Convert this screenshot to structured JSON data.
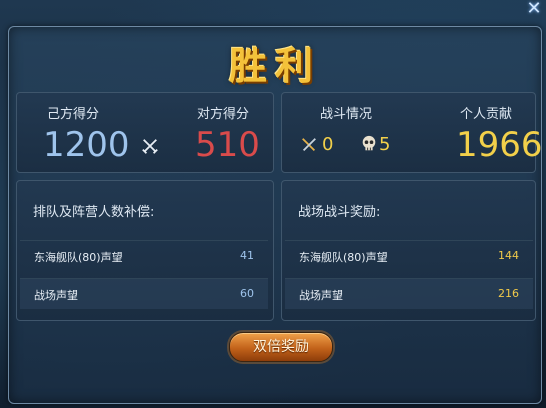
{
  "title": "胜利",
  "score": {
    "own_label": "己方得分",
    "own_value": "1200",
    "enemy_label": "对方得分",
    "enemy_value": "510"
  },
  "battle": {
    "label": "战斗情况",
    "kills": "0",
    "deaths": "5",
    "contribution_label": "个人贡献",
    "contribution_value": "1966"
  },
  "compensation": {
    "title": "排队及阵营人数补偿:",
    "rows": [
      {
        "name": "东海舰队(80)声望",
        "value": "41"
      },
      {
        "name": "战场声望",
        "value": "60"
      }
    ]
  },
  "battle_reward": {
    "title": "战场战斗奖励:",
    "rows": [
      {
        "name": "东海舰队(80)声望",
        "value": "144"
      },
      {
        "name": "战场声望",
        "value": "216"
      }
    ]
  },
  "double_button": "双倍奖励",
  "icons": {
    "close": "close-icon",
    "versus": "crossed-swords-icon",
    "kills": "crossed-swords-icon",
    "deaths": "skull-icon"
  },
  "colors": {
    "own_score": "#9fc4ec",
    "enemy_score": "#d94b4b",
    "contribution": "#f2d04a",
    "reward_value_gold": "#f0c94a"
  }
}
